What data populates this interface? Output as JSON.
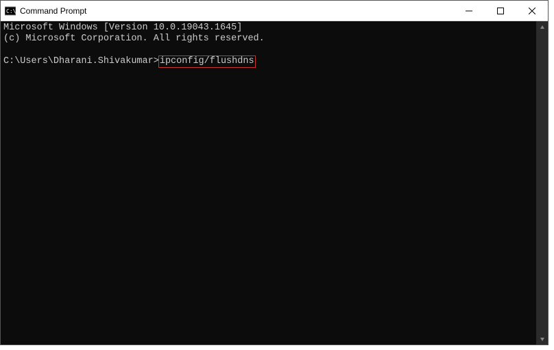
{
  "window": {
    "title": "Command Prompt"
  },
  "terminal": {
    "line1": "Microsoft Windows [Version 10.0.19043.1645]",
    "line2": "(c) Microsoft Corporation. All rights reserved.",
    "blank": "",
    "prompt": "C:\\Users\\Dharani.Shivakumar>",
    "command": "ipconfig/flushdns"
  },
  "highlight": {
    "color": "#cc3333"
  }
}
